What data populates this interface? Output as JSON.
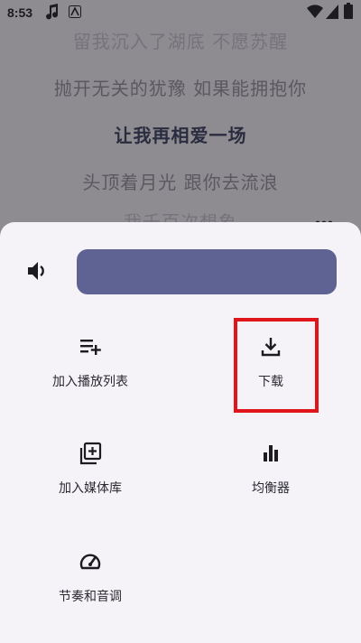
{
  "status_bar": {
    "time": "8:53"
  },
  "lyrics": {
    "lines": [
      "留我沉入了湖底 不愿苏醒",
      "抛开无关的犹豫 如果能拥抱你",
      "让我再相爱一场",
      "头顶着月光 跟你去流浪",
      "我千百次想象"
    ]
  },
  "sheet": {
    "volume": {
      "level": 1.0
    },
    "actions": [
      {
        "label": "加入播放列表",
        "icon": "playlist-add-icon"
      },
      {
        "label": "下载",
        "icon": "download-icon"
      },
      {
        "label": "加入媒体库",
        "icon": "library-add-icon"
      },
      {
        "label": "均衡器",
        "icon": "equalizer-icon"
      },
      {
        "label": "节奏和音调",
        "icon": "speed-icon"
      }
    ]
  },
  "colors": {
    "scrim": "#8e8c91",
    "sheet_bg": "#f5f3f8",
    "accent": "#5f6394",
    "highlight": "#e0141b"
  }
}
